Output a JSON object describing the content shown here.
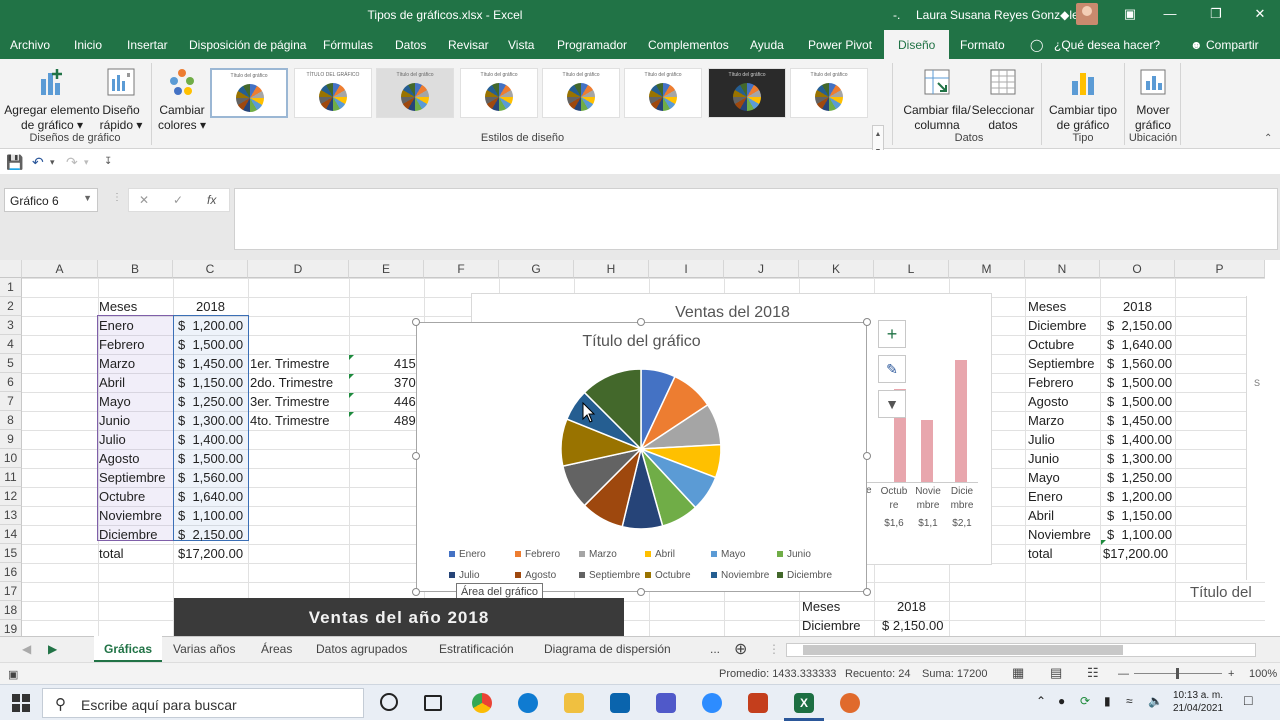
{
  "window": {
    "doc_title": "Tipos de gráficos.xlsx  -  Excel",
    "user_short": "-.",
    "user_name": "Laura Susana Reyes Gonz◆lez"
  },
  "ribbon_tabs": [
    "Archivo",
    "Inicio",
    "Insertar",
    "Disposición de página",
    "Fórmulas",
    "Datos",
    "Revisar",
    "Vista",
    "Programador",
    "Complementos",
    "Ayuda",
    "Power Pivot",
    "Diseño",
    "Formato",
    "¿Qué desea hacer?",
    "Compartir"
  ],
  "ribbon": {
    "add_element": "Agregar elemento de gráfico",
    "quick_layout": "Diseño rápido",
    "change_colors": "Cambiar colores",
    "switch_row_col": "Cambiar fila/ columna",
    "select_data": "Seleccionar datos",
    "change_type": "Cambiar tipo de gráfico",
    "move_chart": "Mover gráfico",
    "groups": {
      "layouts": "Diseños de gráfico",
      "styles": "Estilos de diseño",
      "data": "Datos",
      "type": "Tipo",
      "location": "Ubicación"
    }
  },
  "style_labels": [
    "Título del gráfico",
    "TÍTULO DEL GRÁFICO",
    "Título del gráfico",
    "Título del gráfico",
    "Título del gráfico",
    "Título del gráfico",
    "Título del gráfico",
    "Título del gráfico"
  ],
  "namebox": "Gráfico 6",
  "columns": [
    "A",
    "B",
    "C",
    "D",
    "E",
    "F",
    "G",
    "H",
    "I",
    "J",
    "K",
    "L",
    "M",
    "N",
    "O",
    "P"
  ],
  "rows": [
    "1",
    "2",
    "3",
    "4",
    "5",
    "6",
    "7",
    "8",
    "9",
    "10",
    "11",
    "12",
    "13",
    "14",
    "15",
    "16",
    "17",
    "18",
    "19"
  ],
  "table_left": {
    "header_month": "Meses",
    "header_year": "2018",
    "months": [
      "Enero",
      "Febrero",
      "Marzo",
      "Abril",
      "Mayo",
      "Junio",
      "Julio",
      "Agosto",
      "Septiembre",
      "Octubre",
      "Noviembre",
      "Diciembre"
    ],
    "values": [
      "$  1,200.00",
      "$  1,500.00",
      "$  1,450.00",
      "$  1,150.00",
      "$  1,250.00",
      "$  1,300.00",
      "$  1,400.00",
      "$  1,500.00",
      "$  1,560.00",
      "$  1,640.00",
      "$  1,100.00",
      "$  2,150.00"
    ],
    "total_label": "total",
    "total_value": "$17,200.00"
  },
  "quarters": {
    "labels": [
      "1er. Trimestre",
      "2do. Trimestre",
      "3er. Trimestre",
      "4to. Trimestre"
    ],
    "values": [
      "415",
      "370",
      "446",
      "489"
    ]
  },
  "table_right": {
    "header_month": "Meses",
    "header_year": "2018",
    "months": [
      "Diciembre",
      "Octubre",
      "Septiembre",
      "Febrero",
      "Agosto",
      "Marzo",
      "Julio",
      "Junio",
      "Mayo",
      "Enero",
      "Abril",
      "Noviembre"
    ],
    "values": [
      "$  2,150.00",
      "$  1,640.00",
      "$  1,560.00",
      "$  1,500.00",
      "$  1,500.00",
      "$  1,450.00",
      "$  1,400.00",
      "$  1,300.00",
      "$  1,250.00",
      "$  1,200.00",
      "$  1,150.00",
      "$  1,100.00"
    ],
    "total_label": "total",
    "total_value": "$17,200.00"
  },
  "table_bottom": {
    "header_month": "Meses",
    "header_year": "2018",
    "row_month": "Diciembre",
    "row_value": "$  2,150.00"
  },
  "back_chart": {
    "title": "Ventas del 2018",
    "labels": [
      "e",
      "Octub re",
      "Novie mbre",
      "Dicie mbre"
    ],
    "values": [
      "$1,6",
      "$1,1",
      "$2,1"
    ],
    "side_label": "S"
  },
  "right_chart_title": "Título del",
  "banner": "Ventas del año 2018",
  "tooltip": "Área del gráfico",
  "chart_data": {
    "type": "pie",
    "title": "Título del gráfico",
    "categories": [
      "Enero",
      "Febrero",
      "Marzo",
      "Abril",
      "Mayo",
      "Junio",
      "Julio",
      "Agosto",
      "Septiembre",
      "Octubre",
      "Noviembre",
      "Diciembre"
    ],
    "values": [
      1200,
      1500,
      1450,
      1150,
      1250,
      1300,
      1400,
      1500,
      1560,
      1640,
      1100,
      2150
    ],
    "colors": [
      "#4472c4",
      "#ed7d31",
      "#a5a5a5",
      "#ffc000",
      "#5b9bd5",
      "#70ad47",
      "#264478",
      "#9e480e",
      "#636363",
      "#997300",
      "#255e91",
      "#43682b"
    ],
    "legend": "bottom"
  },
  "sheet_tabs": [
    "Gráficas",
    "Varias años",
    "Áreas",
    "Datos agrupados",
    "Estratificación",
    "Diagrama de dispersión",
    "..."
  ],
  "status": {
    "average": "Promedio: 1433.333333",
    "count": "Recuento: 24",
    "sum": "Suma: 17200",
    "zoom": "100%"
  },
  "taskbar": {
    "search": "Escribe aquí para buscar",
    "time": "10:13 a. m.",
    "date": "21/04/2021"
  }
}
